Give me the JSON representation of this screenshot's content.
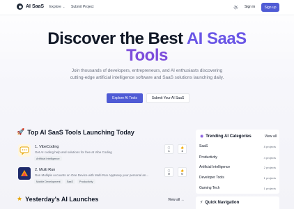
{
  "header": {
    "logo_text": "AI SaaS",
    "nav": {
      "explore": "Explore",
      "submit": "Submit Project"
    },
    "signin": "Sign in",
    "signup": "Sign up"
  },
  "hero": {
    "title_part1": "Discover the Best ",
    "title_accent": "AI SaaS",
    "title_line2": "Tools",
    "subtitle": "Join thousands of developers, entrepreneurs, and AI enthusiasts discovering cutting-edge artificial intelligence software and SaaS solutions launching daily.",
    "explore_btn": "Explore AI Tools",
    "submit_btn": "Submit Your AI SaaS"
  },
  "top_tools": {
    "title": "Top AI SaaS Tools Launching Today",
    "items": [
      {
        "name": "1. VibeCoding",
        "desc": "Get AI coding help and solutions for free at Vibe Coding",
        "tags": [
          "Artificial Intelligence"
        ],
        "comments": "1",
        "likes": "1"
      },
      {
        "name": "2. Multi Run",
        "desc": "Run Multiple Accounts on One Device with Multi Run AppKeep your personal an...",
        "tags": [
          "Mobile Development",
          "SaaS",
          "Productivity"
        ],
        "comments": "0",
        "likes": "0"
      }
    ]
  },
  "yesterday": {
    "title": "Yesterday's AI Launches",
    "view_all": "View all →"
  },
  "trending": {
    "title": "Trending AI Categories",
    "view_all": "View all",
    "categories": [
      {
        "name": "SaaS",
        "count": "8 projects"
      },
      {
        "name": "Productivity",
        "count": "4 projects"
      },
      {
        "name": "Artificial Intelligence",
        "count": "2 projects"
      },
      {
        "name": "Developer Tools",
        "count": "1 projects"
      },
      {
        "name": "Gaming Tech",
        "count": "1 projects"
      }
    ]
  },
  "quick_nav": {
    "title": "Quick Navigation"
  },
  "colors": {
    "primary": "#4f5bd5",
    "accent_gradient_start": "#6a56e6",
    "accent_gradient_end": "#7c4ddb"
  }
}
